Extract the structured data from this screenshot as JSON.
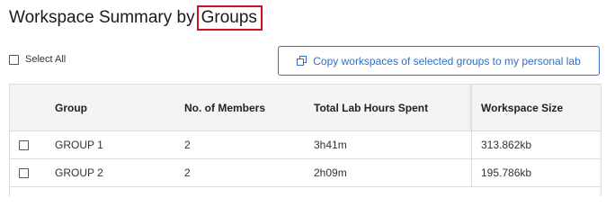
{
  "page": {
    "title_prefix": "Workspace Summary by",
    "title_highlight": "Groups"
  },
  "toolbar": {
    "select_all_label": "Select All",
    "copy_button_label": "Copy workspaces of selected groups to my personal lab",
    "copy_icon": "copy-icon",
    "accent_color": "#2f6fc6",
    "highlight_border_color": "#d0101b"
  },
  "table": {
    "columns": [
      "Group",
      "No. of Members",
      "Total Lab Hours Spent",
      "Workspace Size"
    ],
    "rows": [
      {
        "group": "GROUP 1",
        "members": "2",
        "hours": "3h41m",
        "size": "313.862kb",
        "checked": false
      },
      {
        "group": "GROUP 2",
        "members": "2",
        "hours": "2h09m",
        "size": "195.786kb",
        "checked": false
      }
    ]
  }
}
